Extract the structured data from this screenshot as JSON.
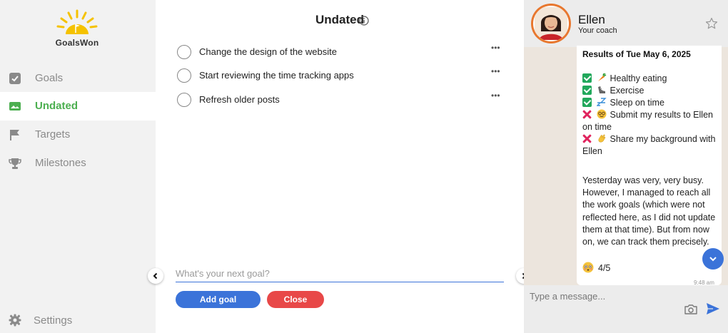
{
  "brand": {
    "name": "GoalsWon"
  },
  "sidebar": {
    "items": [
      {
        "label": "Goals",
        "icon": "check-box-icon"
      },
      {
        "label": "Undated",
        "icon": "inbox-icon",
        "active": true
      },
      {
        "label": "Targets",
        "icon": "flag-icon"
      },
      {
        "label": "Milestones",
        "icon": "trophy-icon"
      }
    ],
    "settings_label": "Settings"
  },
  "main": {
    "title": "Undated",
    "goals": [
      "Change the design of the website",
      "Start reviewing the time tracking apps",
      "Refresh older posts"
    ],
    "more_glyph": "•••",
    "input_placeholder": "What's your next goal?",
    "add_label": "Add goal",
    "close_label": "Close"
  },
  "chat": {
    "coach_name": "Ellen",
    "coach_role": "Your coach",
    "message": {
      "title": "Results of Tue May 6, 2025",
      "items": [
        {
          "status": "done",
          "emoji": "carrot",
          "text": "Healthy eating"
        },
        {
          "status": "done",
          "emoji": "shoe",
          "text": "Exercise"
        },
        {
          "status": "done",
          "emoji": "zzz",
          "text": "Sleep on time"
        },
        {
          "status": "missed",
          "emoji": "nerd-face",
          "text": "Submit my results to Ellen on time"
        },
        {
          "status": "missed",
          "emoji": "waving-hand",
          "text": "Share my background with Ellen"
        }
      ],
      "paragraph": "Yesterday was very, very busy. However, I managed to reach all the work goals (which were not reflected here, as I did not update them at that time). But from now on, we can track them precisely.",
      "rating": "4/5",
      "time": "9:48 am"
    },
    "input_placeholder": "Type a message..."
  },
  "colors": {
    "accent_green": "#4caf50",
    "primary_blue": "#3b73d9",
    "danger_red": "#e84848",
    "avatar_ring": "#e8772e",
    "chat_bg": "#ece5dd"
  }
}
